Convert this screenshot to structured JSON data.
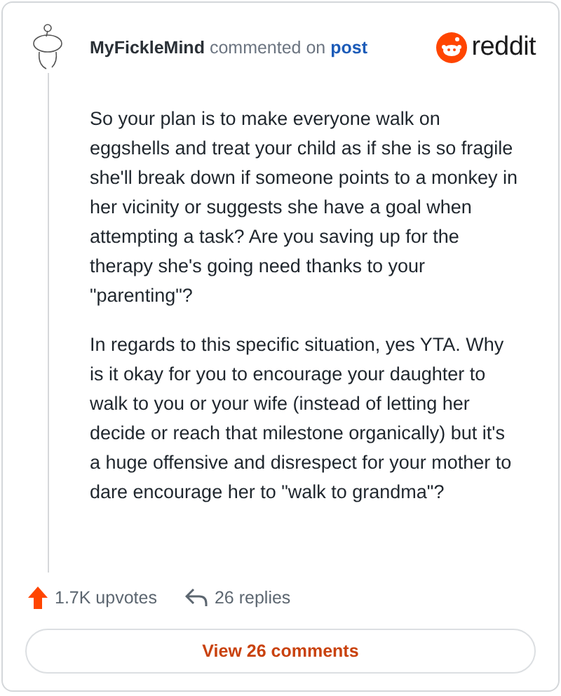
{
  "comment": {
    "author": "MyFickleMind",
    "action": "commented on",
    "target": "post",
    "paragraphs": [
      "So your plan is to make everyone walk on eggshells and treat your child as if she is so fragile she'll break down if someone points to a monkey in her vicinity or suggests she have a goal when attempting a task? Are you saving up for the therapy she's going need thanks to your \"parenting\"?",
      "In regards to this specific situation, yes YTA. Why is it okay for you to encourage your daughter to walk to you or your wife (instead of letting her decide or reach that milestone organically) but it's a huge offensive and disrespect for your mother to dare encourage her to \"walk to grandma\"?"
    ],
    "upvotes": "1.7K upvotes",
    "replies": "26 replies"
  },
  "brand": "reddit",
  "button": "View 26 comments"
}
